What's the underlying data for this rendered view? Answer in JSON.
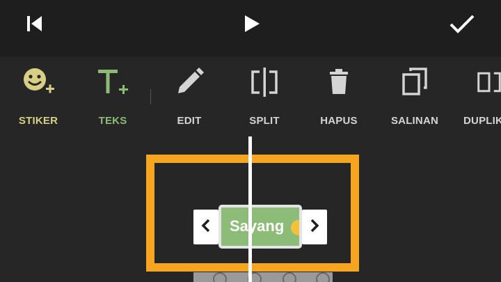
{
  "topbar": {
    "skip_back_icon": "skip-to-start-icon",
    "play_icon": "play-icon",
    "done_icon": "checkmark-icon"
  },
  "toolbar": {
    "items": [
      {
        "label": "STIKER",
        "icon": "sticker-add-icon",
        "color": "#d9cf84"
      },
      {
        "label": "TEKS",
        "icon": "text-add-icon",
        "color": "#8dbb78"
      },
      {
        "label": "EDIT",
        "icon": "pencil-icon",
        "color": "#d4d4d4"
      },
      {
        "label": "SPLIT",
        "icon": "split-icon",
        "color": "#d4d4d4"
      },
      {
        "label": "HAPUS",
        "icon": "trash-icon",
        "color": "#d4d4d4"
      },
      {
        "label": "SALINAN",
        "icon": "copy-icon",
        "color": "#d4d4d4"
      },
      {
        "label": "DUPLIK",
        "icon": "duplicate-icon",
        "color": "#d4d4d4"
      }
    ]
  },
  "timeline": {
    "text_clip_label": "Sayang",
    "text_clip_color": "#8dbb78",
    "highlight_color": "#f5a51f"
  }
}
